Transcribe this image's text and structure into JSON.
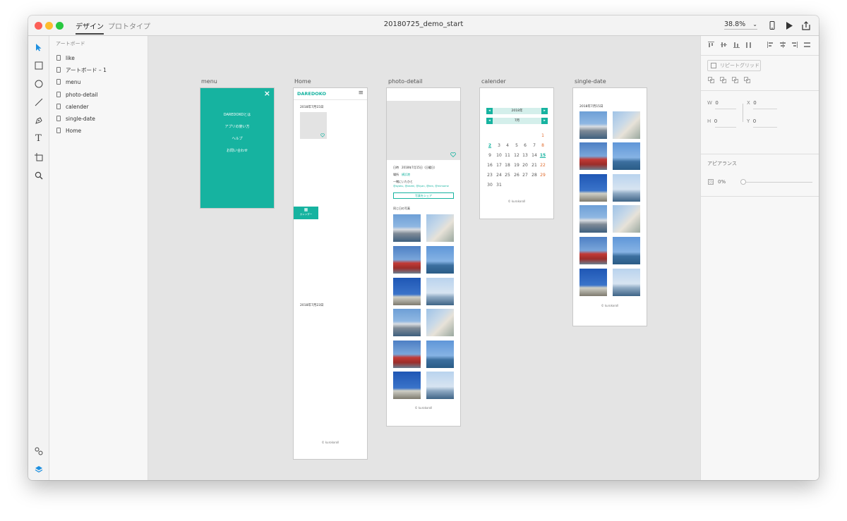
{
  "titlebar": {
    "tabs": [
      {
        "label": "デザイン",
        "active": true
      },
      {
        "label": "プロトタイプ",
        "active": false
      }
    ],
    "document_title": "20180725_demo_start",
    "zoom": "38.8%"
  },
  "toolbar": {
    "tools": [
      "select-arrow-icon",
      "rectangle-icon",
      "ellipse-icon",
      "line-icon",
      "pen-icon",
      "text-icon",
      "artboard-icon",
      "zoom-icon"
    ],
    "bottom": [
      "assets-icon",
      "layers-icon"
    ]
  },
  "layers": {
    "header": "アートボード",
    "items": [
      "like",
      "アートボード – 1",
      "menu",
      "photo-detail",
      "calender",
      "single-date",
      "Home"
    ]
  },
  "artboards": {
    "menu": {
      "label": "menu",
      "items": [
        "DAREDOKOとは",
        "アプリの使い方",
        "ヘルプ",
        "お問い合わせ"
      ],
      "close": "×"
    },
    "home": {
      "label": "Home",
      "brand": "DAREDOKO",
      "date1": "2018年7月15日",
      "date2": "2018年7月23日",
      "footer": "© kurokoroll",
      "calendar_button": "カレンダー"
    },
    "photo_detail": {
      "label": "photo-detail",
      "meta_date_label": "日時",
      "meta_date_value": "2018年7月15日（日曜日）",
      "meta_place_label": "場所",
      "meta_place_value": "横浜港",
      "with_label": "一緒にいたひと",
      "with_value": "@ayaku, @daimi, @kyan, @ken, @mimame",
      "share_button": "写真をシェア",
      "same_day": "同じ日の写真",
      "footer": "© kurokoroll"
    },
    "calender": {
      "label": "calender",
      "year": "2018年",
      "month": "7月",
      "rows": [
        [
          "",
          "",
          "",
          "",
          "",
          "",
          "1"
        ],
        [
          "2",
          "3",
          "4",
          "5",
          "6",
          "7",
          "8"
        ],
        [
          "9",
          "10",
          "11",
          "12",
          "13",
          "14",
          "15"
        ],
        [
          "16",
          "17",
          "18",
          "19",
          "20",
          "21",
          "22"
        ],
        [
          "23",
          "24",
          "25",
          "26",
          "27",
          "28",
          "29"
        ],
        [
          "30",
          "31",
          "",
          "",
          "",
          "",
          ""
        ]
      ],
      "footer": "© kurokoroll"
    },
    "single_date": {
      "label": "single-date",
      "date": "2018年7月15日",
      "footer": "© kurokoroll"
    }
  },
  "props": {
    "repeat_grid": "リピートグリッド",
    "w_label": "W",
    "w_value": "0",
    "x_label": "X",
    "x_value": "0",
    "h_label": "H",
    "h_value": "0",
    "y_label": "Y",
    "y_value": "0",
    "appearance": "アピアランス",
    "opacity": "0%"
  },
  "colors": {
    "accent": "#16b3a0",
    "sunday": "#16b3a0",
    "saturday": "#e06a2c"
  }
}
